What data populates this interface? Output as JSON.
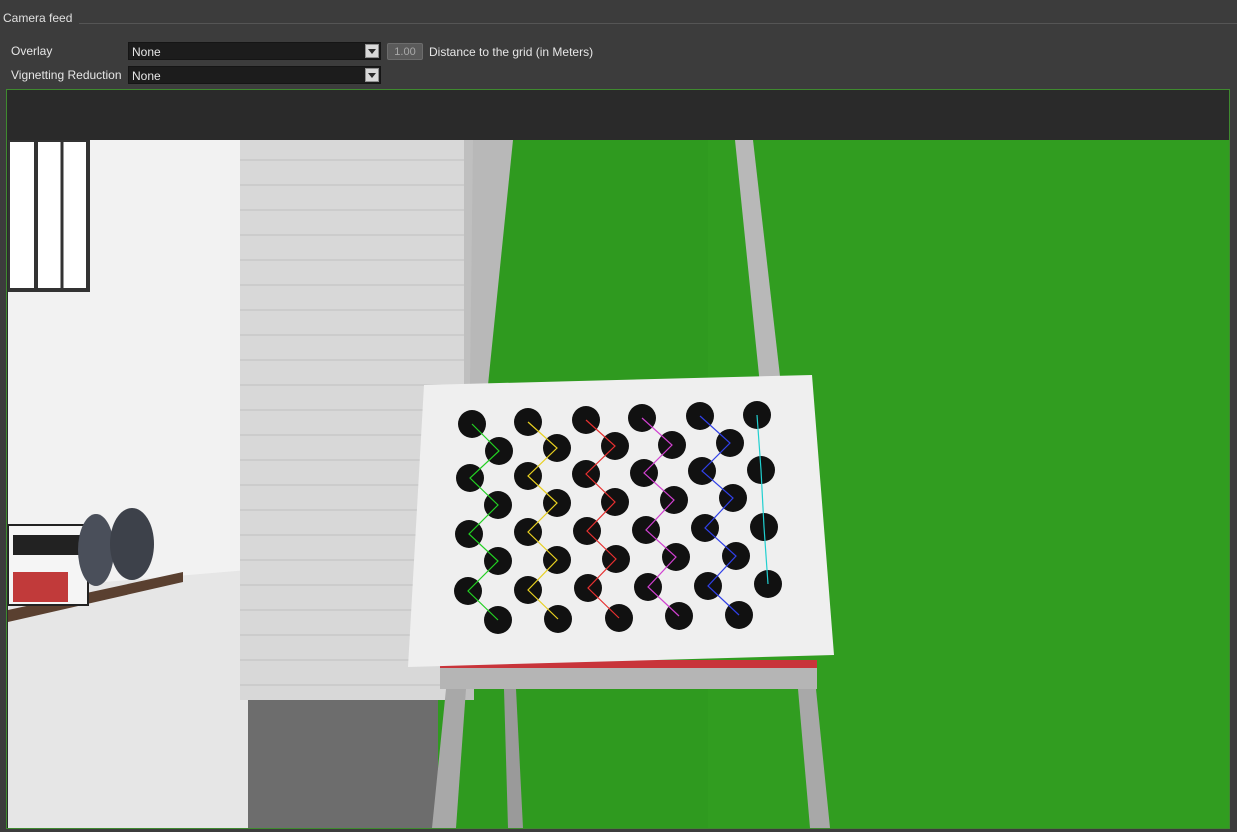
{
  "panel": {
    "title": "Camera feed"
  },
  "overlay": {
    "label": "Overlay",
    "selected": "None",
    "distance_value": "1.00",
    "distance_label": "Distance to the grid (in Meters)"
  },
  "vignetting": {
    "label": "Vignetting Reduction",
    "selected": "None"
  },
  "icons": {
    "dropdown": "chevron-down-icon"
  },
  "colors": {
    "frame_border": "#3f8a2f",
    "green_screen": "#2f9a1f"
  }
}
